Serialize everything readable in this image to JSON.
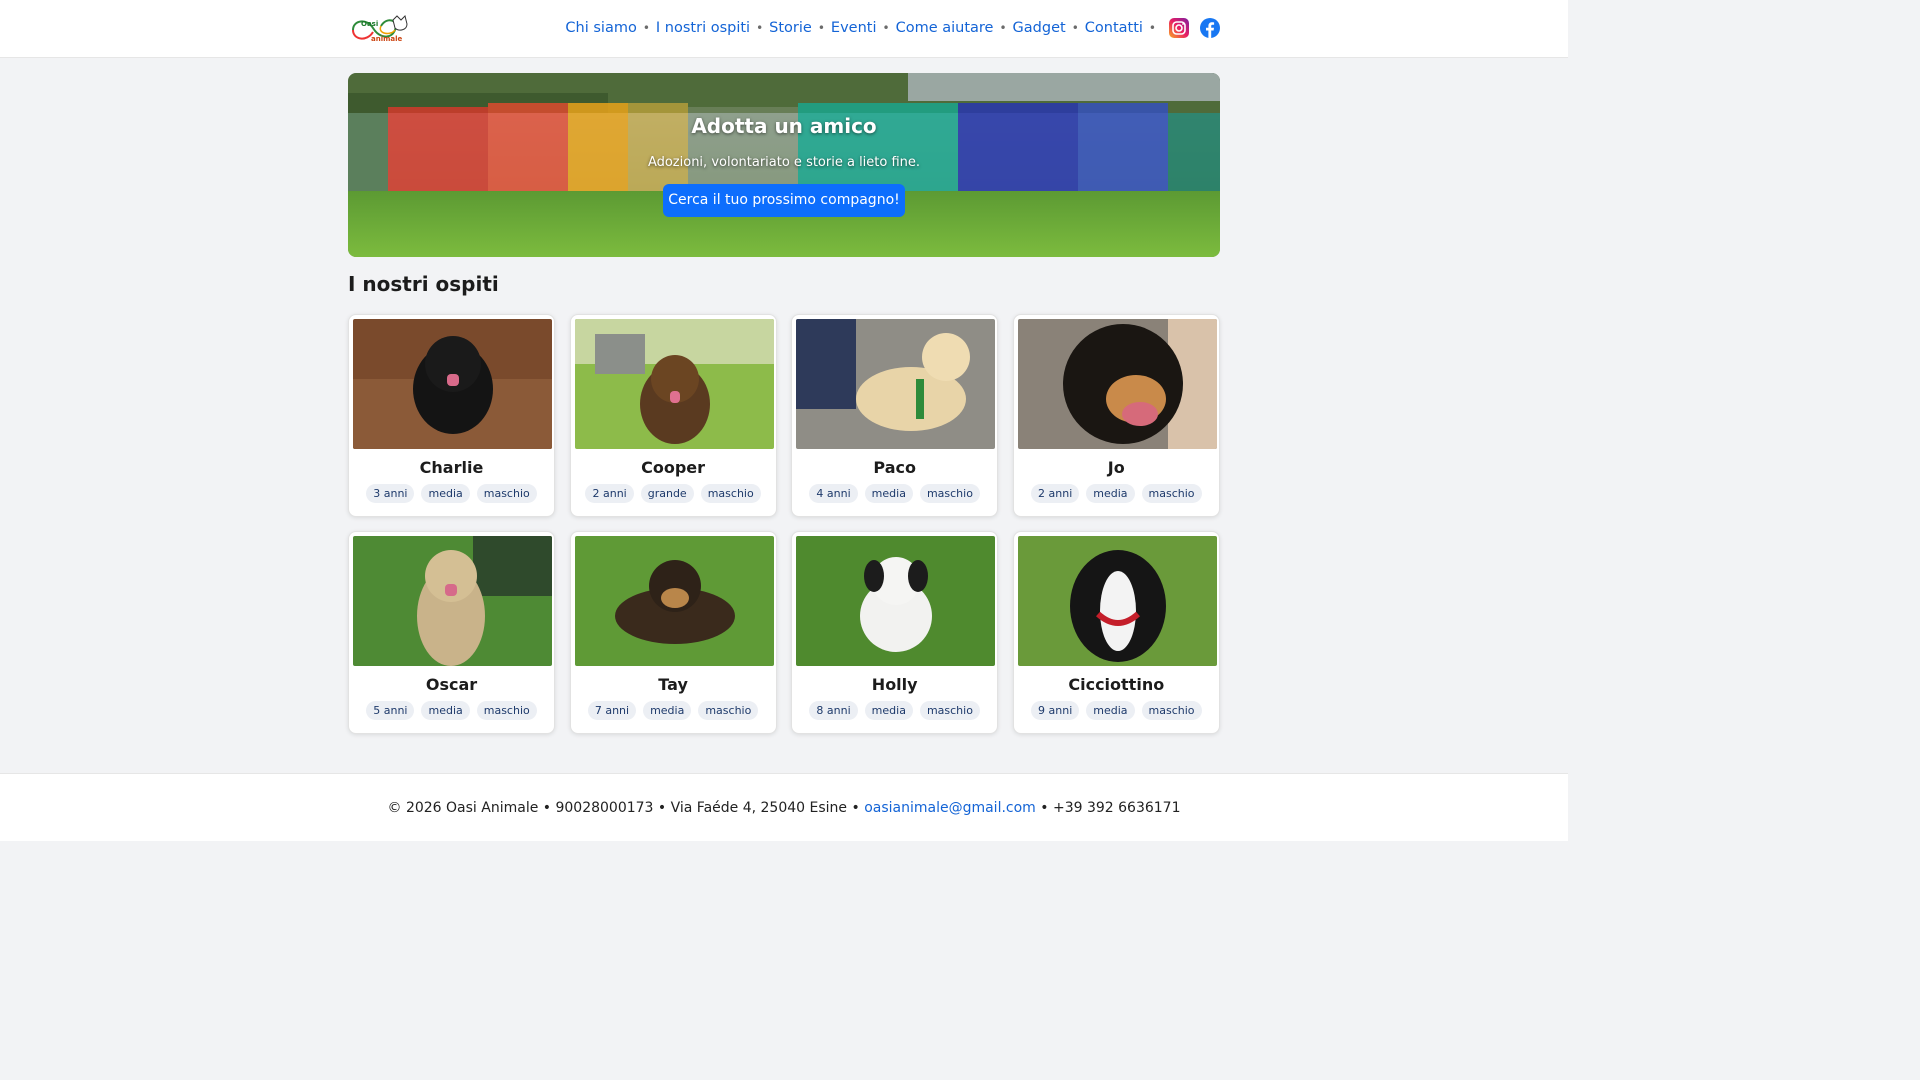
{
  "brand": {
    "logo_name": "Oasi Animale"
  },
  "nav": {
    "items": [
      {
        "label": "Chi siamo"
      },
      {
        "label": "I nostri ospiti"
      },
      {
        "label": "Storie"
      },
      {
        "label": "Eventi"
      },
      {
        "label": "Come aiutare"
      },
      {
        "label": "Gadget"
      },
      {
        "label": "Contatti"
      }
    ],
    "separator": "•",
    "social": [
      "instagram-icon",
      "facebook-icon"
    ]
  },
  "hero": {
    "title": "Adotta un amico",
    "subtitle": "Adozioni, volontariato e storie a lieto fine.",
    "cta": "Cerca il tuo prossimo compagno!"
  },
  "section": {
    "title": "I nostri ospiti"
  },
  "animals": [
    {
      "name": "Charlie",
      "age": "3 anni",
      "size": "media",
      "sex": "maschio"
    },
    {
      "name": "Cooper",
      "age": "2 anni",
      "size": "grande",
      "sex": "maschio"
    },
    {
      "name": "Paco",
      "age": "4 anni",
      "size": "media",
      "sex": "maschio"
    },
    {
      "name": "Jo",
      "age": "2 anni",
      "size": "media",
      "sex": "maschio"
    },
    {
      "name": "Oscar",
      "age": "5 anni",
      "size": "media",
      "sex": "maschio"
    },
    {
      "name": "Tay",
      "age": "7 anni",
      "size": "media",
      "sex": "maschio"
    },
    {
      "name": "Holly",
      "age": "8 anni",
      "size": "media",
      "sex": "maschio"
    },
    {
      "name": "Cicciottino",
      "age": "9 anni",
      "size": "media",
      "sex": "maschio"
    }
  ],
  "footer": {
    "prefix": "© 2026 Oasi Animale • 90028000173 • Via Faéde 4, 25040 Esine •",
    "email": "oasianimale@gmail.com",
    "suffix": "• +39 392 6636171"
  },
  "colors": {
    "accent": "#0d6efd",
    "link": "#1464d6",
    "tag_bg": "#eceff4"
  }
}
